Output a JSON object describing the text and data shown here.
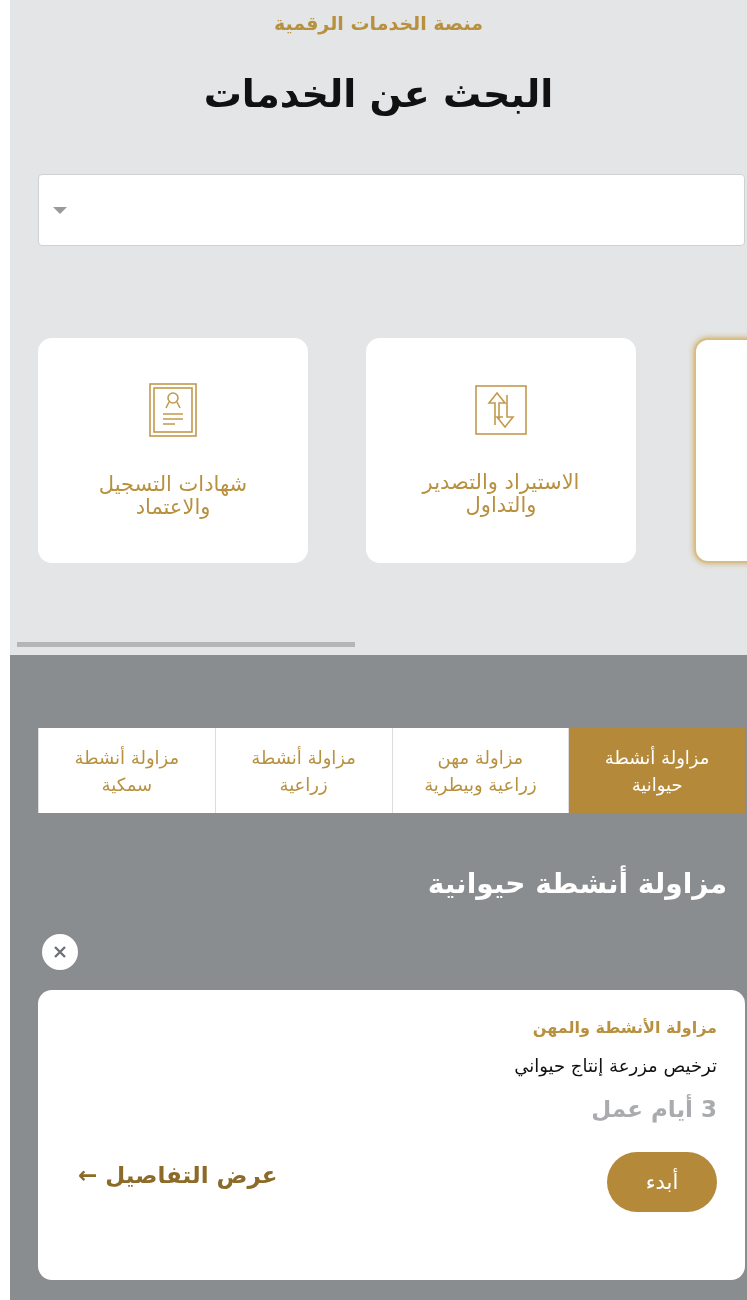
{
  "header": {
    "platform": "منصة الخدمات الرقمية",
    "title": "البحث عن الخدمات"
  },
  "search": {
    "kind": "dropdown"
  },
  "categories": [
    {
      "kind": "blank",
      "selected": true
    },
    {
      "kind": "arrows",
      "label": "الاستيراد والتصدير والتداول",
      "selected": false
    },
    {
      "kind": "certificate",
      "label": "شهادات التسجيل والاعتماد",
      "selected": false
    }
  ],
  "tabs": [
    {
      "label": "مزاولة أنشطة حيوانية",
      "selected": true
    },
    {
      "label": "مزاولة مهن زراعية وبيطرية",
      "selected": false
    },
    {
      "label": "مزاولة أنشطة زراعية",
      "selected": false
    },
    {
      "label": "مزاولة أنشطة سمكية",
      "selected": false
    }
  ],
  "section_title": "مزاولة أنشطة حيوانية",
  "service": {
    "category": "مزاولة الأنشطة والمهن",
    "name": "ترخيص مزرعة إنتاج حيواني",
    "duration": "3 أيام عمل",
    "start": "أبدء",
    "details": "عرض التفاصيل ←"
  }
}
